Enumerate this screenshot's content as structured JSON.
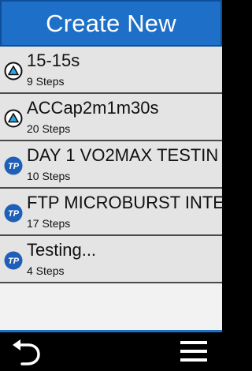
{
  "header": {
    "title": "Create New"
  },
  "workouts": [
    {
      "title": "15-15s",
      "steps": "9 Steps",
      "icon": "garmin-triangle-icon"
    },
    {
      "title": "ACCap2m1m30s",
      "steps": "20 Steps",
      "icon": "garmin-triangle-icon"
    },
    {
      "title": "DAY 1 VO2MAX TESTIN",
      "steps": "10 Steps",
      "icon": "trainingpeaks-icon"
    },
    {
      "title": "FTP MICROBURST INTE",
      "steps": "17 Steps",
      "icon": "trainingpeaks-icon"
    },
    {
      "title": "Testing...",
      "steps": "4 Steps",
      "icon": "trainingpeaks-icon"
    }
  ],
  "icons": {
    "tp_label": "TP"
  },
  "footer": {
    "back_icon": "back-arrow-icon",
    "menu_icon": "hamburger-menu-icon"
  },
  "colors": {
    "accent": "#1d6fc7",
    "icon_blue": "#1f5fb8",
    "triangle_cyan": "#2ba6e8"
  }
}
